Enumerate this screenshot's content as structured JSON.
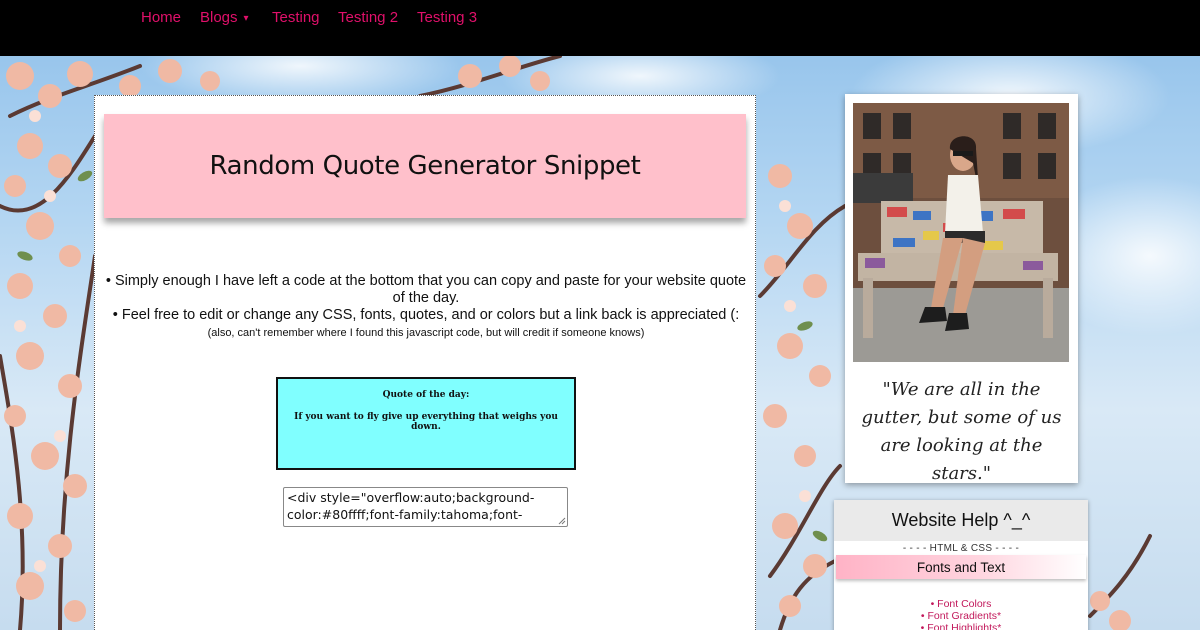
{
  "nav": {
    "items": [
      {
        "label": "Home"
      },
      {
        "label": "Blogs",
        "caret": "▾"
      },
      {
        "label": "Testing"
      },
      {
        "label": "Testing 2"
      },
      {
        "label": "Testing 3"
      }
    ],
    "link_color": "#e0106a"
  },
  "main": {
    "title": "Random Quote Generator Snippet",
    "intro_line1": "• Simply enough I have left a code at the bottom that you can copy and paste for your website quote of the day.",
    "intro_line2": "• Feel free to edit or change any CSS, fonts, quotes, and or colors but a link back is appreciated (:",
    "intro_note": "(also, can't remember where I found this javascript code, but will credit if someone knows)",
    "quote_box": {
      "label": "Quote of the day:",
      "text": "If you want to fly give up everything that weighs you down.",
      "background": "#80ffff"
    },
    "code_snippet": "<div style=\"overflow:auto;background-color:#80ffff;font-family:tahoma;font-"
  },
  "sidebar": {
    "polaroid_caption": "\"We are all in the gutter, but some of us are looking at the stars.\"",
    "help": {
      "title": "Website Help ^_^",
      "section": "- - - - HTML & CSS - - - -",
      "tab": "Fonts and Text",
      "links": [
        "• Font Colors",
        "• Font Gradients*",
        "• Font Highlights*"
      ]
    }
  },
  "colors": {
    "banner": "#ffc0cb",
    "nav_bg": "#000000"
  }
}
